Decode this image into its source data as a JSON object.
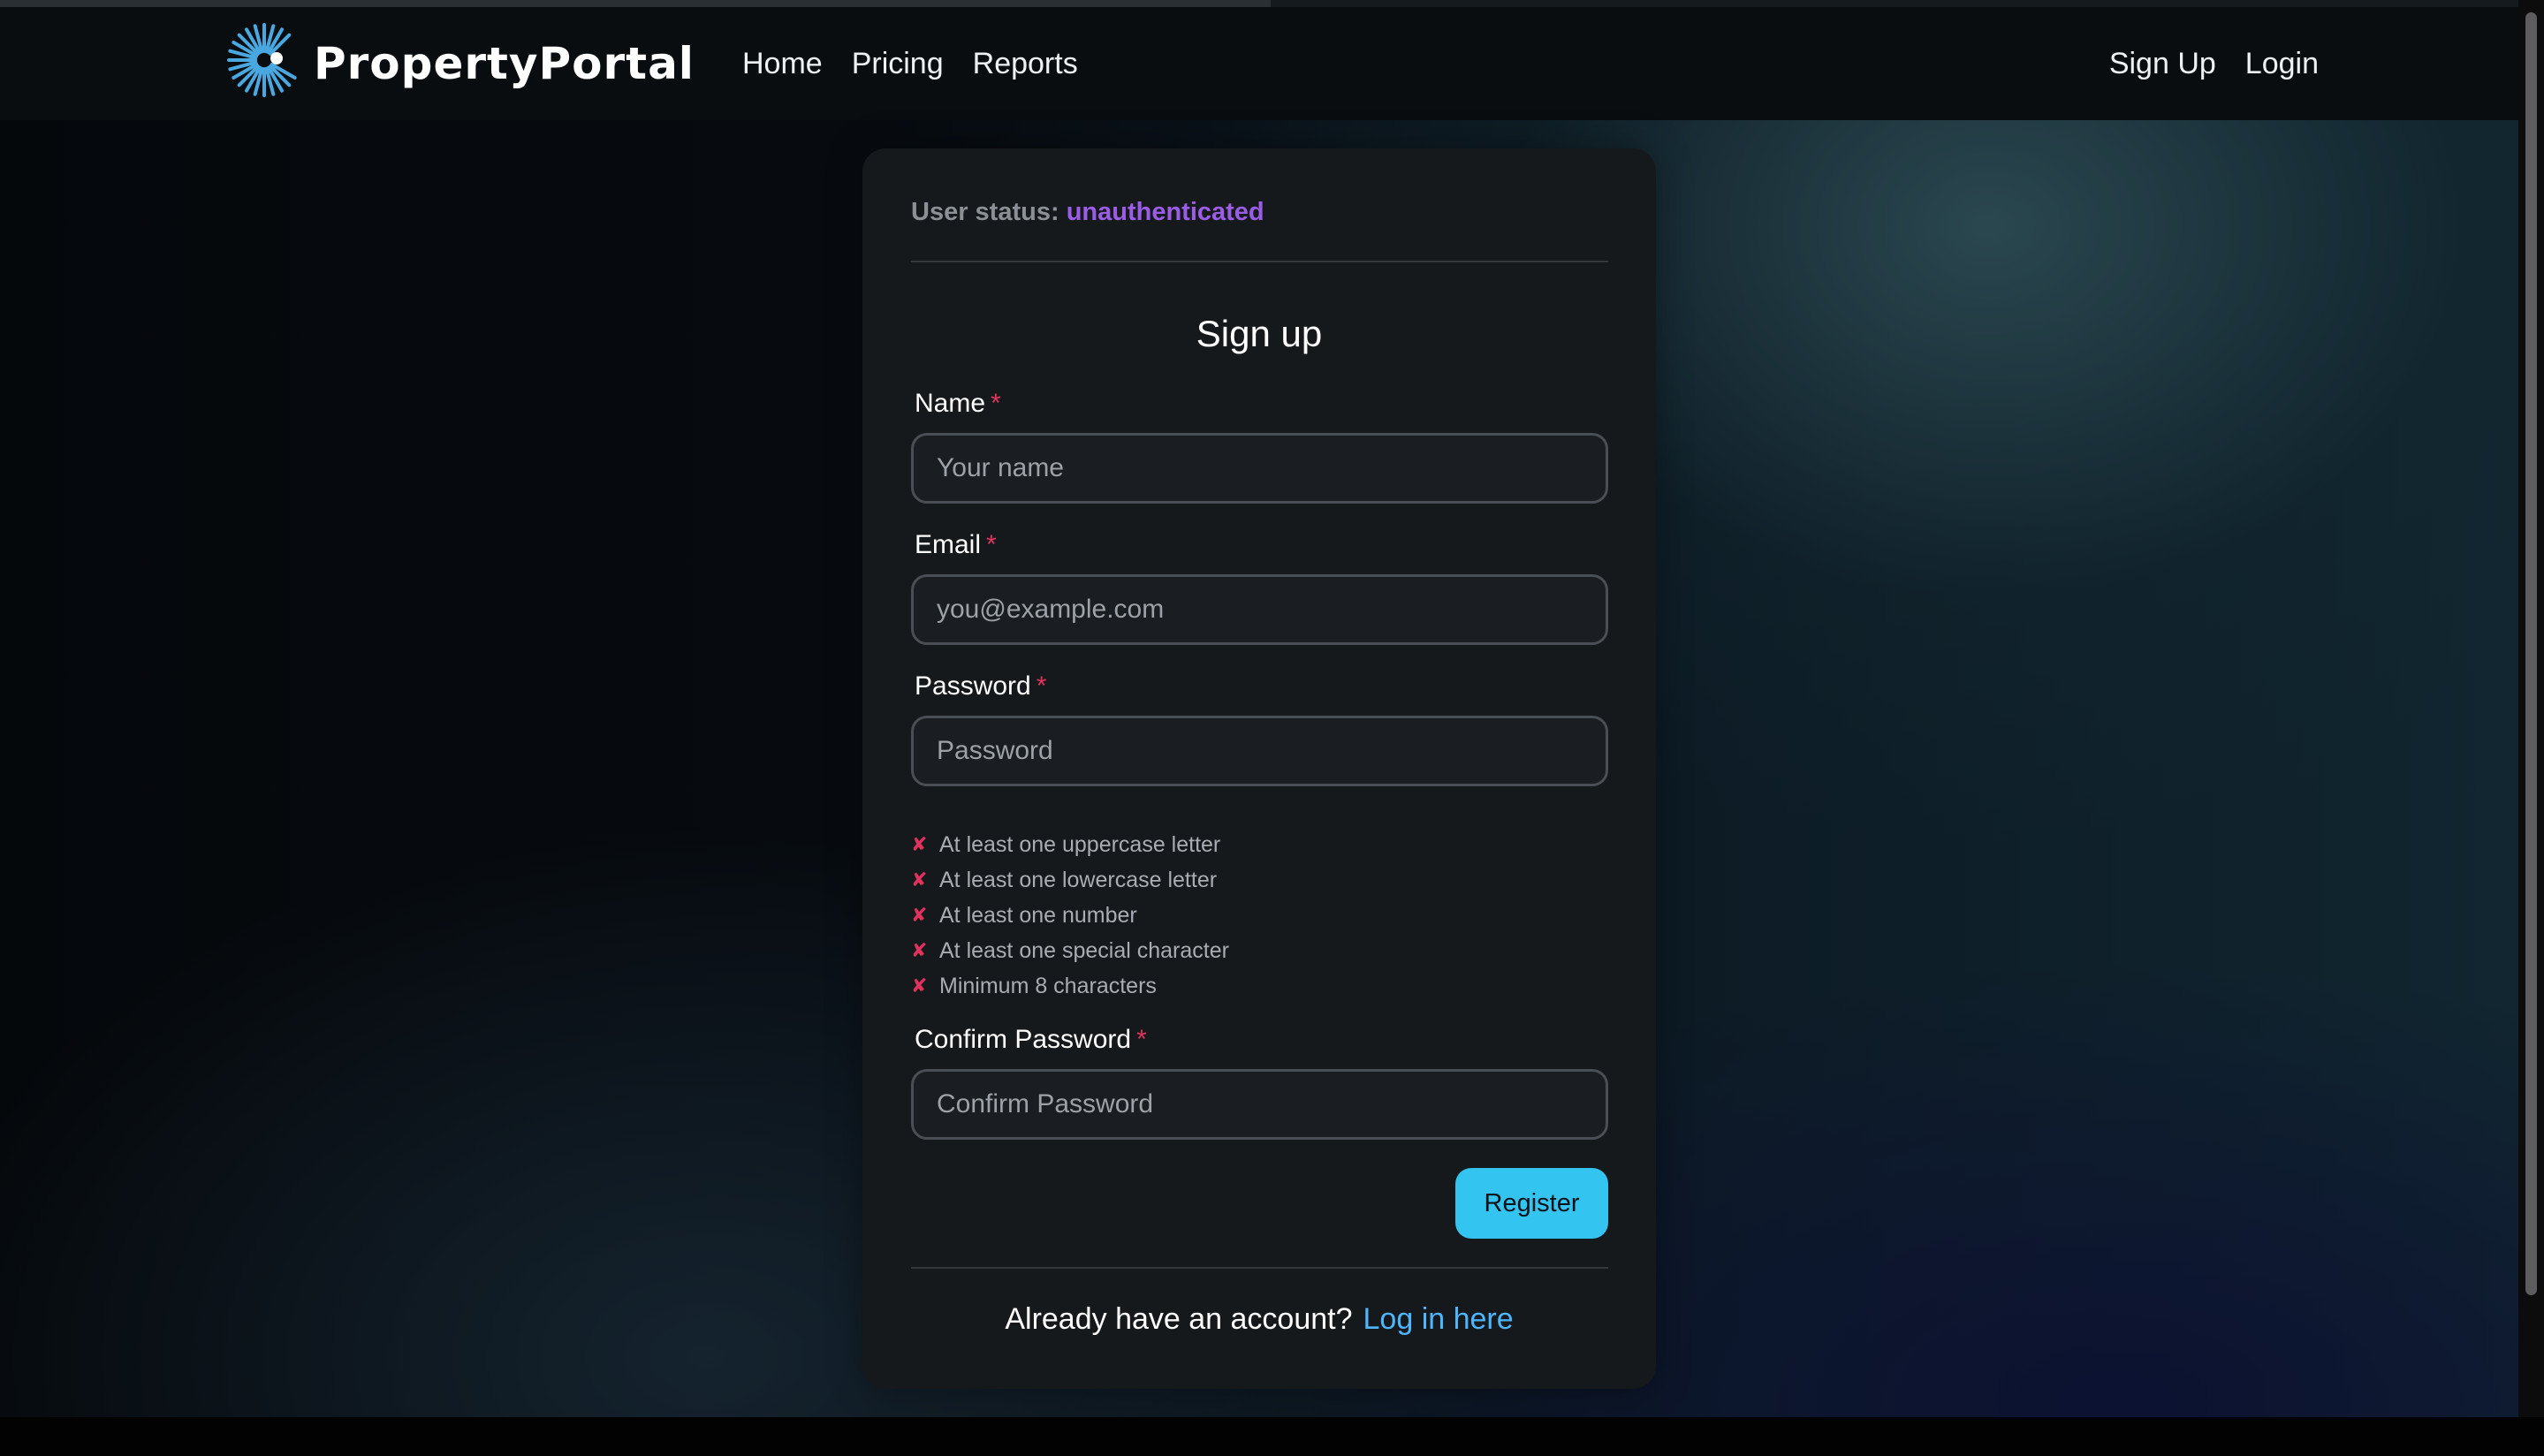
{
  "app": {
    "brand": "PropertyPortal",
    "logo_icon": "sunburst-logo-icon",
    "accent_color": "#34c4f0",
    "brand_color": "#4aa8e0"
  },
  "nav": {
    "left": [
      {
        "label": "Home"
      },
      {
        "label": "Pricing"
      },
      {
        "label": "Reports"
      }
    ],
    "right": [
      {
        "label": "Sign Up"
      },
      {
        "label": "Login"
      }
    ]
  },
  "card": {
    "status_label": "User status:",
    "status_value": "unauthenticated",
    "status_color": "#9b5de5",
    "title": "Sign up",
    "fields": {
      "name": {
        "label": "Name",
        "required_mark": "*",
        "placeholder": "Your name",
        "value": ""
      },
      "email": {
        "label": "Email",
        "required_mark": "*",
        "placeholder": "you@example.com",
        "value": ""
      },
      "password": {
        "label": "Password",
        "required_mark": "*",
        "placeholder": "Password",
        "value": ""
      },
      "confirm_password": {
        "label": "Confirm Password",
        "required_mark": "*",
        "placeholder": "Confirm Password",
        "value": ""
      }
    },
    "password_rules": [
      {
        "icon": "✘",
        "text": "At least one uppercase letter",
        "met": false
      },
      {
        "icon": "✘",
        "text": "At least one lowercase letter",
        "met": false
      },
      {
        "icon": "✘",
        "text": "At least one number",
        "met": false
      },
      {
        "icon": "✘",
        "text": "At least one special character",
        "met": false
      },
      {
        "icon": "✘",
        "text": "Minimum 8 characters",
        "met": false
      }
    ],
    "register_label": "Register",
    "footer_text": "Already have an account?",
    "footer_link": "Log in here"
  }
}
